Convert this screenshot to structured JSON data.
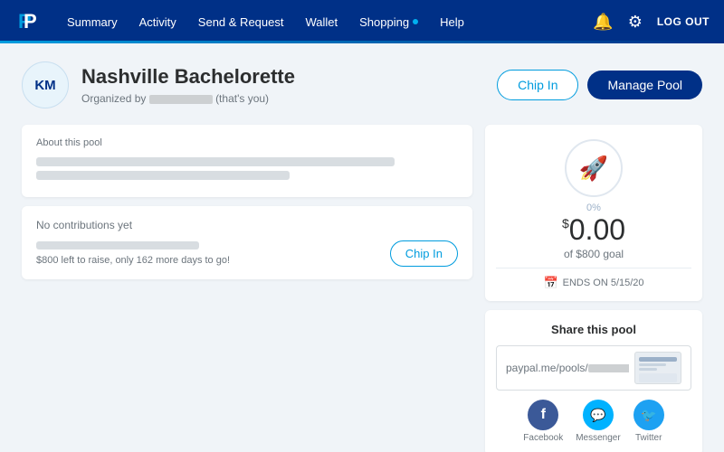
{
  "nav": {
    "links": [
      {
        "label": "Summary",
        "has_dot": false
      },
      {
        "label": "Activity",
        "has_dot": false
      },
      {
        "label": "Send & Request",
        "has_dot": false
      },
      {
        "label": "Wallet",
        "has_dot": false
      },
      {
        "label": "Shopping",
        "has_dot": true
      },
      {
        "label": "Help",
        "has_dot": false
      }
    ],
    "logout_label": "LOG OUT"
  },
  "pool": {
    "avatar_initials": "KM",
    "title": "Nashville Bachelorette",
    "subtitle_prefix": "Organized by",
    "subtitle_suffix": "(that's you)",
    "chip_in_label": "Chip In",
    "manage_pool_label": "Manage Pool"
  },
  "about_card": {
    "label": "About this pool"
  },
  "contributions_card": {
    "no_contrib_label": "No contributions yet",
    "remaining_text": "$800 left to raise, only 162 more days to go!",
    "chip_in_label": "Chip In"
  },
  "goal_card": {
    "percent": "0%",
    "dollar_sign": "$",
    "amount": "0.00",
    "of_goal_text": "of $800 goal",
    "ends_label": "ENDS ON 5/15/20"
  },
  "share_card": {
    "title": "Share this pool",
    "link_prefix": "paypal.me/pools/",
    "facebook_label": "Facebook",
    "messenger_label": "Messenger",
    "twitter_label": "Twitter"
  }
}
